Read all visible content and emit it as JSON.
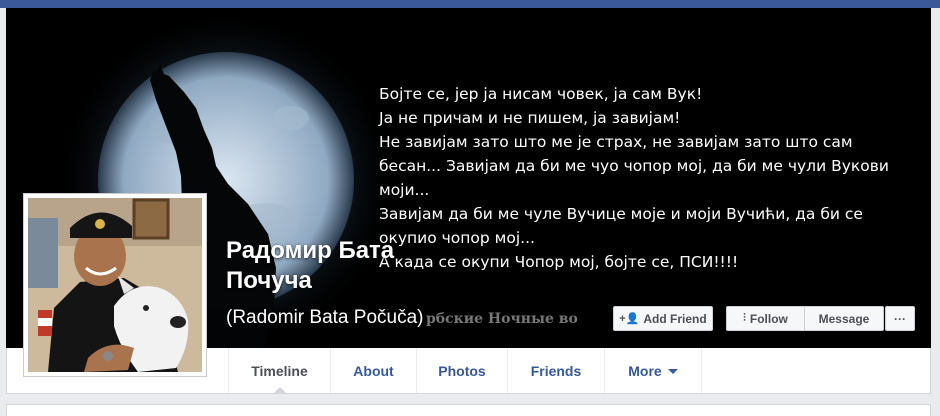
{
  "cover": {
    "lines": "Бојте се, јер ја нисам човек, ја сам Вук!\nЈа не причам и не пишем, ја завијам!\nНе завијам зато што ме је страх, не завијам зато што сам бесан... Завијам да би ме чуо чопор мој, да би ме чули Вукови моји...\nЗавијам да би ме чуле Вучице моје и моји Вучићи, да би се окупио чопор мој...\nА када се окупи Чопор мој, бојте се, ПСИ!!!!",
    "ghost_caption": "рбские Ночные во"
  },
  "profile": {
    "name": "Радомир Бата Почуча",
    "alternate_name": "(Radomir Bata Počuča)"
  },
  "actions": {
    "add_friend": "Add Friend",
    "follow": "Follow",
    "message": "Message",
    "more_dots": "···"
  },
  "tabs": {
    "timeline": "Timeline",
    "about": "About",
    "photos": "Photos",
    "friends": "Friends",
    "more": "More"
  },
  "colors": {
    "brand": "#3b5998",
    "link": "#365899"
  }
}
